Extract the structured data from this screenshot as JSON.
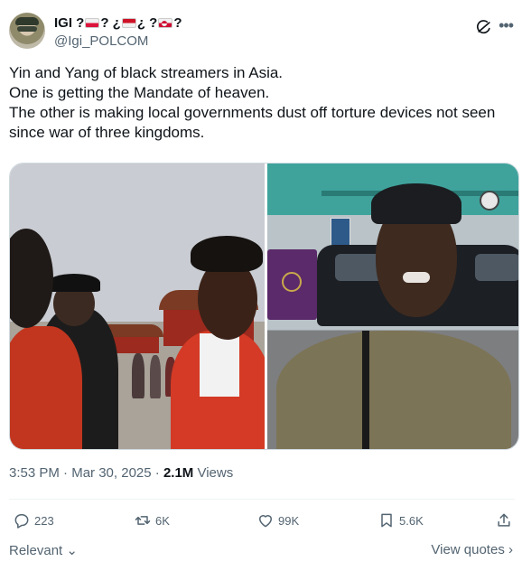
{
  "author": {
    "display_name": "IGI ?",
    "name_suffix_1": "? ¿",
    "name_suffix_2": "¿ ?",
    "name_suffix_3": "?",
    "handle": "@Igi_POLCOM"
  },
  "tweet": {
    "lines": [
      "Yin and Yang of black streamers in Asia.",
      "One is getting the Mandate of heaven.",
      "The other is making local governments dust off torture devices not seen",
      "since war of three kingdoms."
    ]
  },
  "meta": {
    "time": "3:53 PM",
    "separator": "·",
    "date": "Mar 30, 2025",
    "views_count": "2.1M",
    "views_label": "Views"
  },
  "actions": {
    "replies": "223",
    "reposts": "6K",
    "likes": "99K",
    "bookmarks": "5.6K"
  },
  "footer": {
    "sort_label": "Relevant",
    "quotes_label": "View quotes"
  },
  "icons": [
    "grok-icon",
    "more-icon",
    "reply-icon",
    "repost-icon",
    "like-icon",
    "bookmark-icon",
    "share-icon",
    "chevron-down-icon",
    "chevron-right-icon"
  ],
  "colors": {
    "text": "#0f1419",
    "secondary": "#536471",
    "border": "#cfd9de"
  }
}
